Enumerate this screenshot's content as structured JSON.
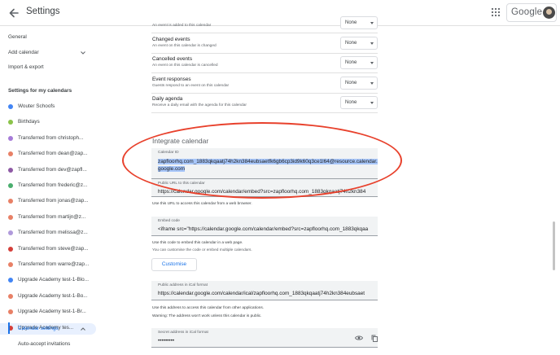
{
  "header": {
    "title": "Settings",
    "google_label": "Google"
  },
  "sidebar": {
    "general": "General",
    "add_calendar": "Add calendar",
    "import_export": "Import & export",
    "section_title": "Settings for my calendars",
    "calendars": [
      {
        "label": "Wouter Schoofs",
        "color": "#4285f4"
      },
      {
        "label": "Birthdays",
        "color": "#8bc34a"
      },
      {
        "label": "Transferred from christoph...",
        "color": "#a67bd8"
      },
      {
        "label": "Transferred from dean@zap...",
        "color": "#e88066"
      },
      {
        "label": "Transferred from dev@zapfl...",
        "color": "#8e5aa5"
      },
      {
        "label": "Transferred from frederic@z...",
        "color": "#4aae6e"
      },
      {
        "label": "Transferred from jonas@zap...",
        "color": "#e88066"
      },
      {
        "label": "Transferred from martijn@z...",
        "color": "#e88066"
      },
      {
        "label": "Transferred from melissa@z...",
        "color": "#b09adb"
      },
      {
        "label": "Transferred from steve@zap...",
        "color": "#d43f3a"
      },
      {
        "label": "Transferred from warre@zap...",
        "color": "#e88066"
      },
      {
        "label": "Upgrade Academy test-1-Blo...",
        "color": "#4285f4"
      },
      {
        "label": "Upgrade Academy test-1-Bo...",
        "color": "#e88066"
      },
      {
        "label": "Upgrade Academy test-1-Br...",
        "color": "#e88066"
      },
      {
        "label": "Upgrade Academy tes...",
        "color": "#d43f3a"
      }
    ],
    "calendar_settings": "Calendar settings",
    "auto_accept": "Auto-accept invitations"
  },
  "notifications": {
    "top_desc": "An event is added to this calendar",
    "top_value": "None",
    "rows": [
      {
        "title": "Changed events",
        "desc": "An event on this calendar is changed",
        "value": "None"
      },
      {
        "title": "Cancelled events",
        "desc": "An event on this calendar is cancelled",
        "value": "None"
      },
      {
        "title": "Event responses",
        "desc": "Guests respond to an event on this calendar",
        "value": "None"
      },
      {
        "title": "Daily agenda",
        "desc": "Receive a daily email with the agenda for this calendar",
        "value": "None"
      }
    ]
  },
  "integrate": {
    "heading": "Integrate calendar",
    "calendar_id_label": "Calendar ID",
    "calendar_id_value": "zapfloorhq.com_1883qkqaatj74h2kn384eubsaetfk6gb6cp3id9k60q3ce1l64@resource.calendar.google.com",
    "public_url_label": "Public URL to this calendar",
    "public_url_value": "https://calendar.google.com/calendar/embed?src=zapfloorhq.com_1883qkqaatj74h2kn384",
    "public_url_note": "Use this URL to access this calendar from a web browser.",
    "embed_label": "Embed code",
    "embed_value": "<iframe src=\"https://calendar.google.com/calendar/embed?src=zapfloorhq.com_1883qkqaa",
    "embed_note": "Use this code to embed this calendar in a web page.",
    "embed_note2": "You can customise the code or embed multiple calendars.",
    "customise_label": "Customise",
    "ical_label": "Public address in iCal format",
    "ical_value": "https://calendar.google.com/calendar/ical/zapfloorhq.com_1883qkqaatj74h2kn384eubsaet",
    "ical_note": "Use this address to access this calendar from other applications.",
    "ical_warning": "Warning: The address won't work unless this calendar is public.",
    "secret_label": "Secret address in iCal format",
    "secret_value": "•••••••••"
  }
}
